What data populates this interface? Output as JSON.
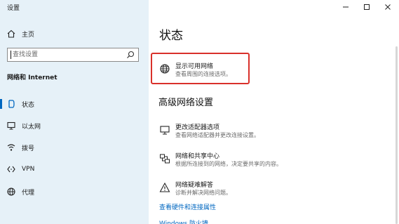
{
  "window": {
    "title": "设置"
  },
  "sidebar": {
    "home_label": "主页",
    "search": {
      "placeholder": "查找设置"
    },
    "section_label": "网络和 Internet",
    "items": [
      {
        "label": "状态",
        "icon": "status-icon",
        "active": true
      },
      {
        "label": "以太网",
        "icon": "ethernet-icon"
      },
      {
        "label": "拨号",
        "icon": "dialup-icon"
      },
      {
        "label": "VPN",
        "icon": "vpn-icon"
      },
      {
        "label": "代理",
        "icon": "proxy-globe-icon"
      }
    ]
  },
  "main": {
    "title": "状态",
    "show_networks": {
      "title": "显示可用网络",
      "desc": "查看周围的连接选项。"
    },
    "advanced_title": "高级网络设置",
    "adapter": {
      "title": "更改适配器选项",
      "desc": "查看网络适配器并更改连接设置。"
    },
    "sharing": {
      "title": "网络和共享中心",
      "desc": "根据所连接到的网络，决定要共享的内容。"
    },
    "troubleshoot": {
      "title": "网络疑难解答",
      "desc": "诊断并解决网络问题。"
    },
    "hw_link": "查看硬件和连接属性",
    "firewall_link_cut": "Windows 防火墙"
  },
  "colors": {
    "sidebar_bg": "#e6f1f8",
    "accent": "#0067c0",
    "highlight": "#d9312b"
  }
}
